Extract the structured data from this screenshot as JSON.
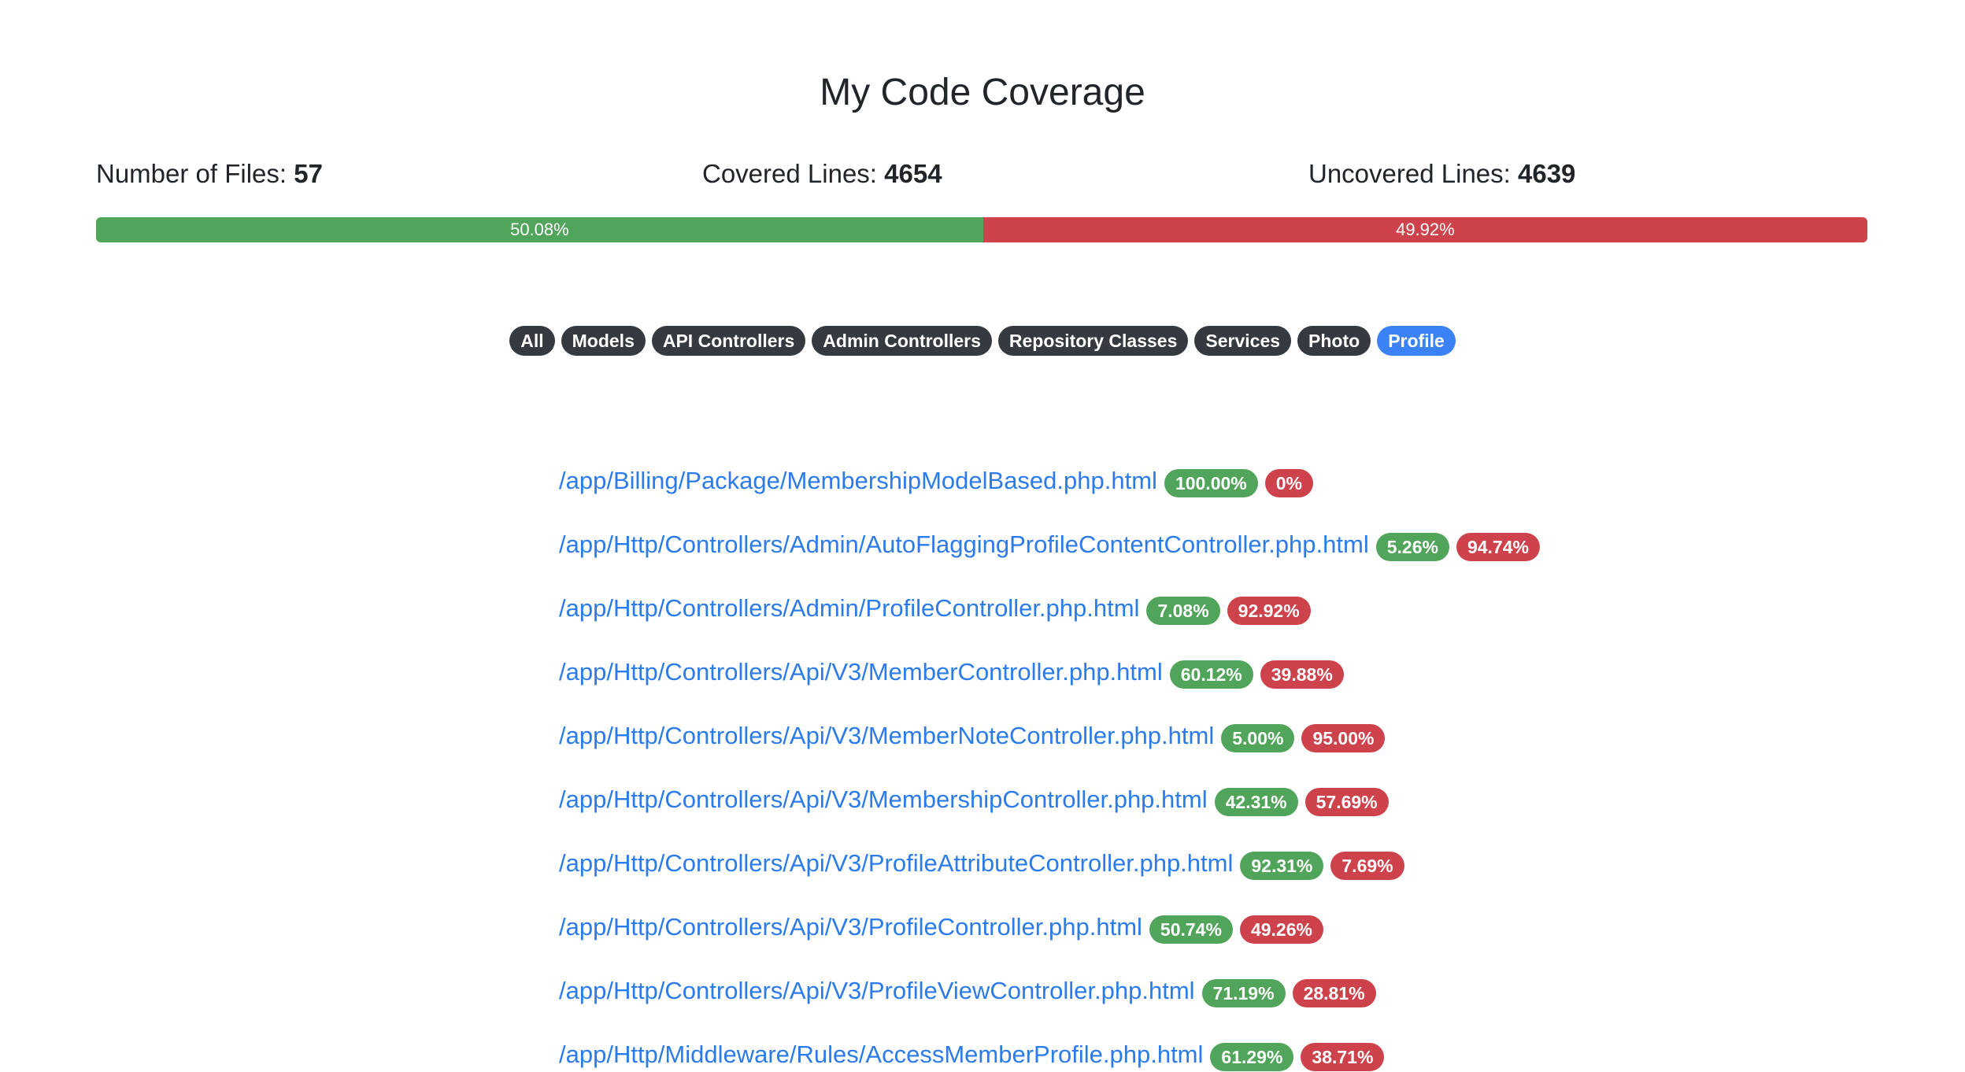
{
  "page": {
    "title": "My Code Coverage"
  },
  "stats": {
    "files_label": "Number of Files:",
    "files_value": "57",
    "covered_label": "Covered Lines:",
    "covered_value": "4654",
    "uncovered_label": "Uncovered Lines:",
    "uncovered_value": "4639"
  },
  "progress": {
    "covered_pct": 50.08,
    "covered_label": "50.08%",
    "uncovered_pct": 49.92,
    "uncovered_label": "49.92%",
    "covered_color": "#50a55a",
    "uncovered_color": "#ce424b"
  },
  "filters": [
    {
      "label": "All",
      "active": false
    },
    {
      "label": "Models",
      "active": false
    },
    {
      "label": "API Controllers",
      "active": false
    },
    {
      "label": "Admin Controllers",
      "active": false
    },
    {
      "label": "Repository Classes",
      "active": false
    },
    {
      "label": "Services",
      "active": false
    },
    {
      "label": "Photo",
      "active": false
    },
    {
      "label": "Profile",
      "active": true
    }
  ],
  "files": [
    {
      "path": "/app/Billing/Package/MembershipModelBased.php.html",
      "covered": "100.00%",
      "uncovered": "0%"
    },
    {
      "path": "/app/Http/Controllers/Admin/AutoFlaggingProfileContentController.php.html",
      "covered": "5.26%",
      "uncovered": "94.74%"
    },
    {
      "path": "/app/Http/Controllers/Admin/ProfileController.php.html",
      "covered": "7.08%",
      "uncovered": "92.92%"
    },
    {
      "path": "/app/Http/Controllers/Api/V3/MemberController.php.html",
      "covered": "60.12%",
      "uncovered": "39.88%"
    },
    {
      "path": "/app/Http/Controllers/Api/V3/MemberNoteController.php.html",
      "covered": "5.00%",
      "uncovered": "95.00%"
    },
    {
      "path": "/app/Http/Controllers/Api/V3/MembershipController.php.html",
      "covered": "42.31%",
      "uncovered": "57.69%"
    },
    {
      "path": "/app/Http/Controllers/Api/V3/ProfileAttributeController.php.html",
      "covered": "92.31%",
      "uncovered": "7.69%"
    },
    {
      "path": "/app/Http/Controllers/Api/V3/ProfileController.php.html",
      "covered": "50.74%",
      "uncovered": "49.26%"
    },
    {
      "path": "/app/Http/Controllers/Api/V3/ProfileViewController.php.html",
      "covered": "71.19%",
      "uncovered": "28.81%"
    },
    {
      "path": "/app/Http/Middleware/Rules/AccessMemberProfile.php.html",
      "covered": "61.29%",
      "uncovered": "38.71%"
    }
  ]
}
